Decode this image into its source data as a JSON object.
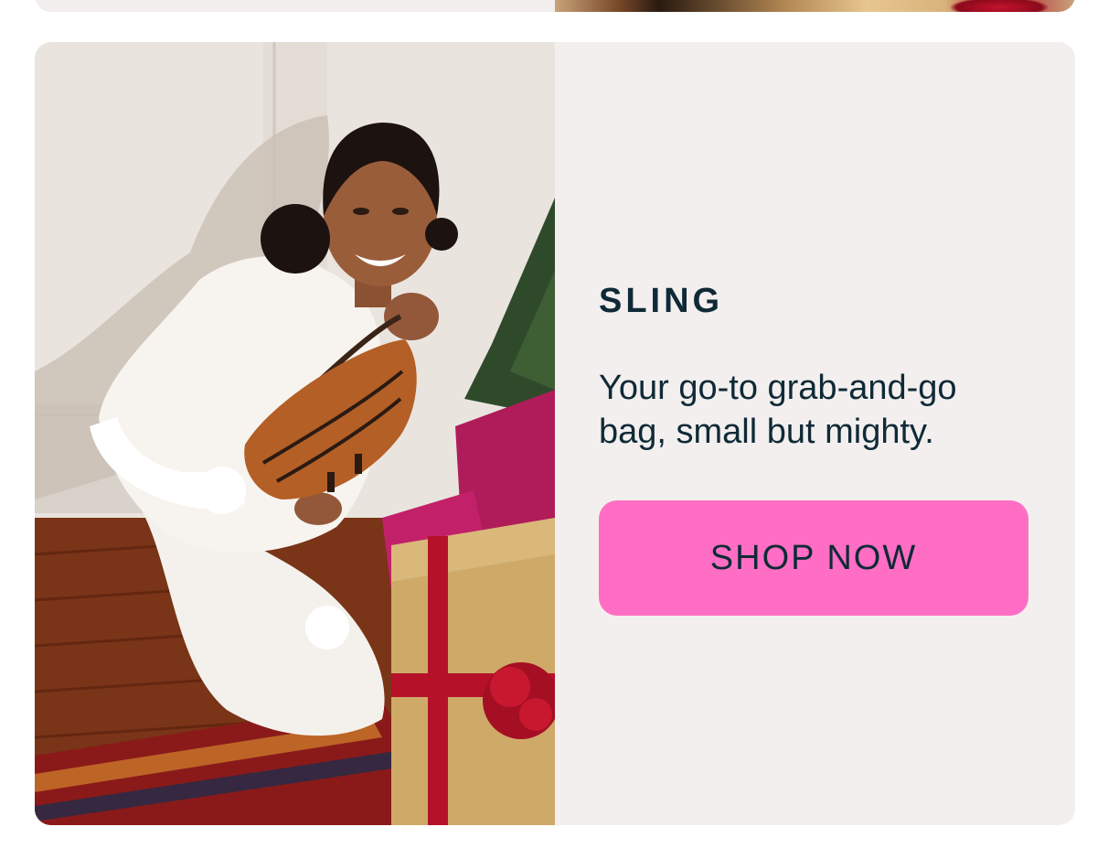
{
  "product": {
    "eyebrow": "SLING",
    "description": "Your go-to grab-and-go bag, small but mighty.",
    "cta_label": "SHOP NOW"
  },
  "colors": {
    "panel_bg": "#f3efef",
    "text": "#0f2a36",
    "cta_bg": "#ff6ec4"
  },
  "photo": {
    "subject": "woman-holding-brown-sling-bag",
    "icon": "product-photo"
  }
}
